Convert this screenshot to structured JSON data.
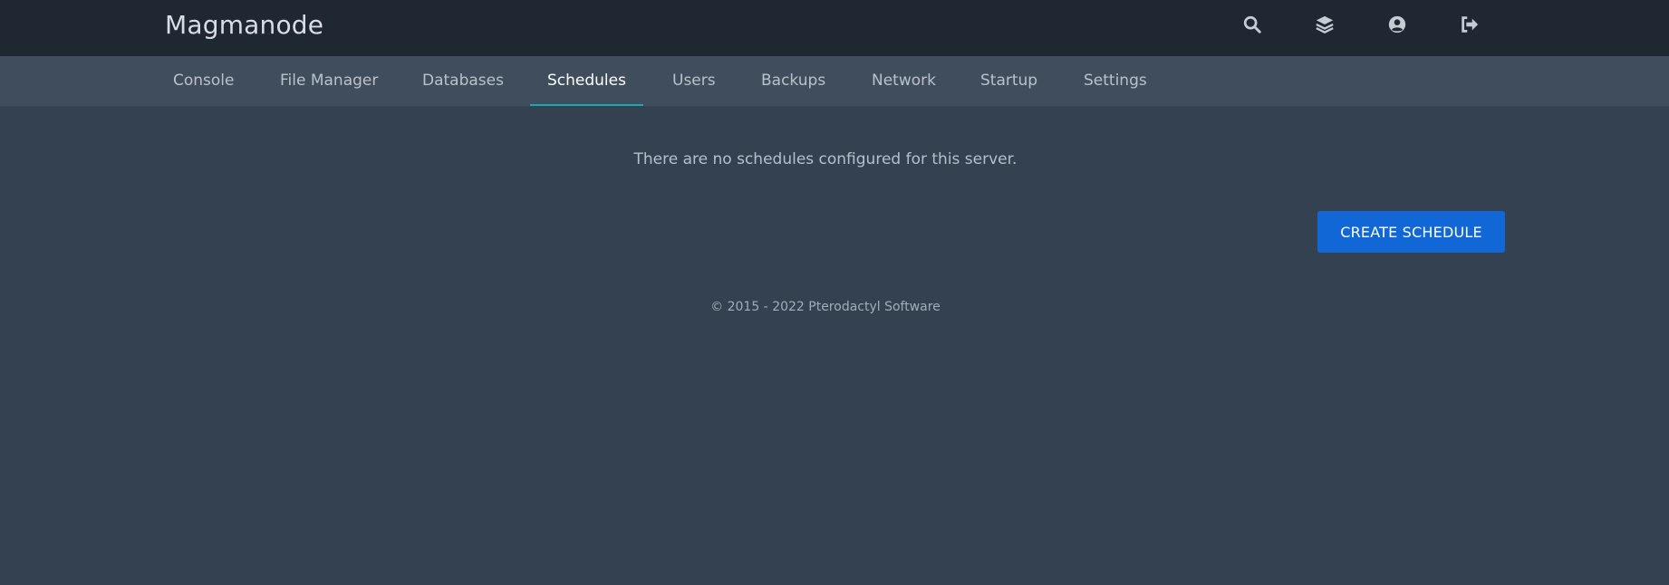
{
  "header": {
    "brand": "Magmanode",
    "icons": [
      "search-icon",
      "layers-icon",
      "user-circle-icon",
      "sign-out-icon"
    ],
    "background": "#1f2733"
  },
  "tabs": [
    {
      "label": "Console",
      "active": false
    },
    {
      "label": "File Manager",
      "active": false
    },
    {
      "label": "Databases",
      "active": false
    },
    {
      "label": "Schedules",
      "active": true
    },
    {
      "label": "Users",
      "active": false
    },
    {
      "label": "Backups",
      "active": false
    },
    {
      "label": "Network",
      "active": false
    },
    {
      "label": "Startup",
      "active": false
    },
    {
      "label": "Settings",
      "active": false
    }
  ],
  "main": {
    "empty_message": "There are no schedules configured for this server.",
    "create_button_label": "CREATE SCHEDULE"
  },
  "footer": {
    "text": "© 2015 - 2022 Pterodactyl Software"
  },
  "colors": {
    "accent": "#1167d6",
    "active_tab_underline": "#1ba8b8",
    "page_background": "#334150"
  }
}
